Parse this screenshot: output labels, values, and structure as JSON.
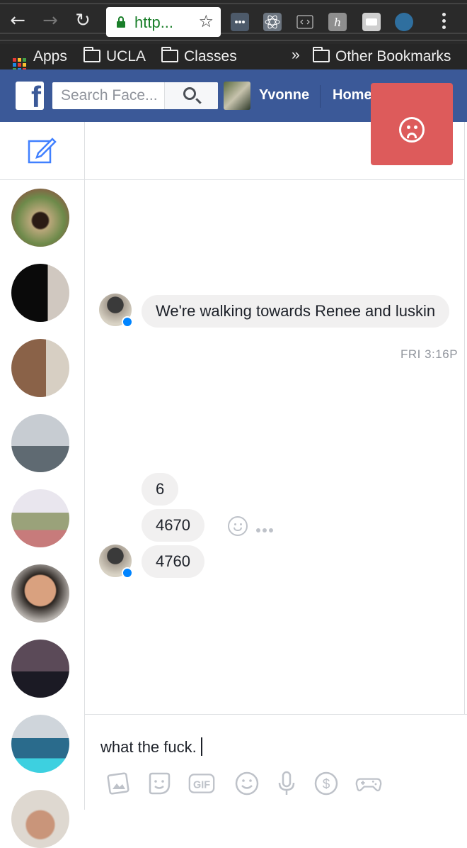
{
  "browser": {
    "url_text": "http...",
    "bookmarks": {
      "apps": "Apps",
      "ucla": "UCLA",
      "classes": "Classes",
      "overflow": "»",
      "other": "Other Bookmarks"
    }
  },
  "facebook": {
    "search_placeholder": "Search Face...",
    "user_name": "Yvonne",
    "home": "Home"
  },
  "messages": {
    "first": "We're walking towards Renee and luskin",
    "timestamp": "FRI 3:16P",
    "group": [
      "6",
      "4670",
      "4760"
    ]
  },
  "composer": {
    "text": "what the fuck.",
    "tools": [
      "photo-icon",
      "sticker-icon",
      "gif-icon",
      "emoji-icon",
      "microphone-icon",
      "payment-icon",
      "game-icon"
    ],
    "gif_label": "GIF",
    "dollar": "$"
  },
  "colors": {
    "facebook_blue": "#3b5998",
    "error_red": "#dd5b5b",
    "messenger_blue": "#0084ff",
    "bubble_gray": "#f1f0f0"
  }
}
